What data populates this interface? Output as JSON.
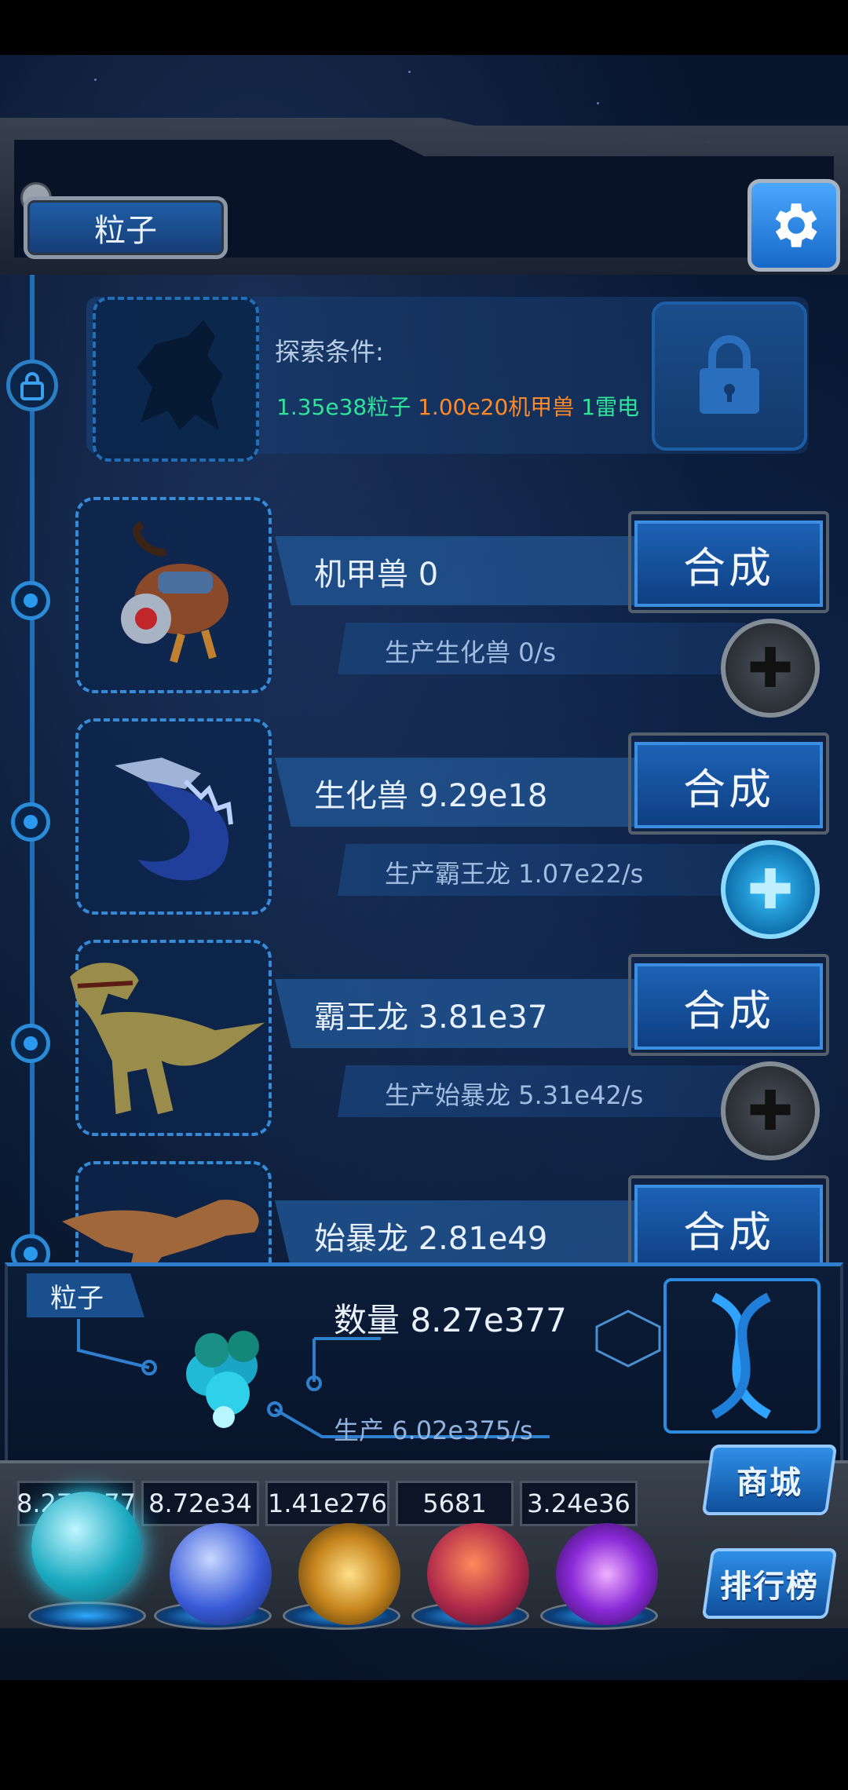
{
  "header": {
    "title": "粒子"
  },
  "explore": {
    "label": "探索条件:",
    "requirements": [
      {
        "text": "1.35e38粒子",
        "color": "#2ee39a"
      },
      {
        "text": "1.00e20机甲兽",
        "color": "#ff8a2a"
      },
      {
        "text": "1雷电",
        "color": "#2ee39a"
      }
    ],
    "icon": "lock-icon"
  },
  "creatures": [
    {
      "name": "机甲兽 0",
      "production": "生产生化兽 0/s",
      "synth_label": "合成",
      "plus_active": false,
      "art": "mecha-beast"
    },
    {
      "name": "生化兽 9.29e18",
      "production": "生产霸王龙 1.07e22/s",
      "synth_label": "合成",
      "plus_active": true,
      "art": "bio-beast"
    },
    {
      "name": "霸王龙 3.81e37",
      "production": "生产始暴龙 5.31e42/s",
      "synth_label": "合成",
      "plus_active": false,
      "art": "t-rex"
    },
    {
      "name": "始暴龙 2.81e49",
      "production": "",
      "synth_label": "合成",
      "plus_active": false,
      "art": "proto-rex"
    }
  ],
  "info": {
    "tab_label": "粒子",
    "count": "数量 8.27e377",
    "rate": "生产 6.02e375/s"
  },
  "resources": [
    {
      "value": "8.27e377",
      "icon": "particle-orb-icon"
    },
    {
      "value": "8.72e34",
      "icon": "lightning-orb-icon"
    },
    {
      "value": "1.41e276",
      "icon": "galaxy-orb-icon"
    },
    {
      "value": "5681",
      "icon": "brain-orb-icon"
    },
    {
      "value": "3.24e36",
      "icon": "vortex-orb-icon"
    }
  ],
  "side_buttons": {
    "shop": "商城",
    "ranking": "排行榜"
  },
  "colors": {
    "accent": "#2f8fe6",
    "panel": "#0c1d38",
    "frame": "#3a424e"
  }
}
